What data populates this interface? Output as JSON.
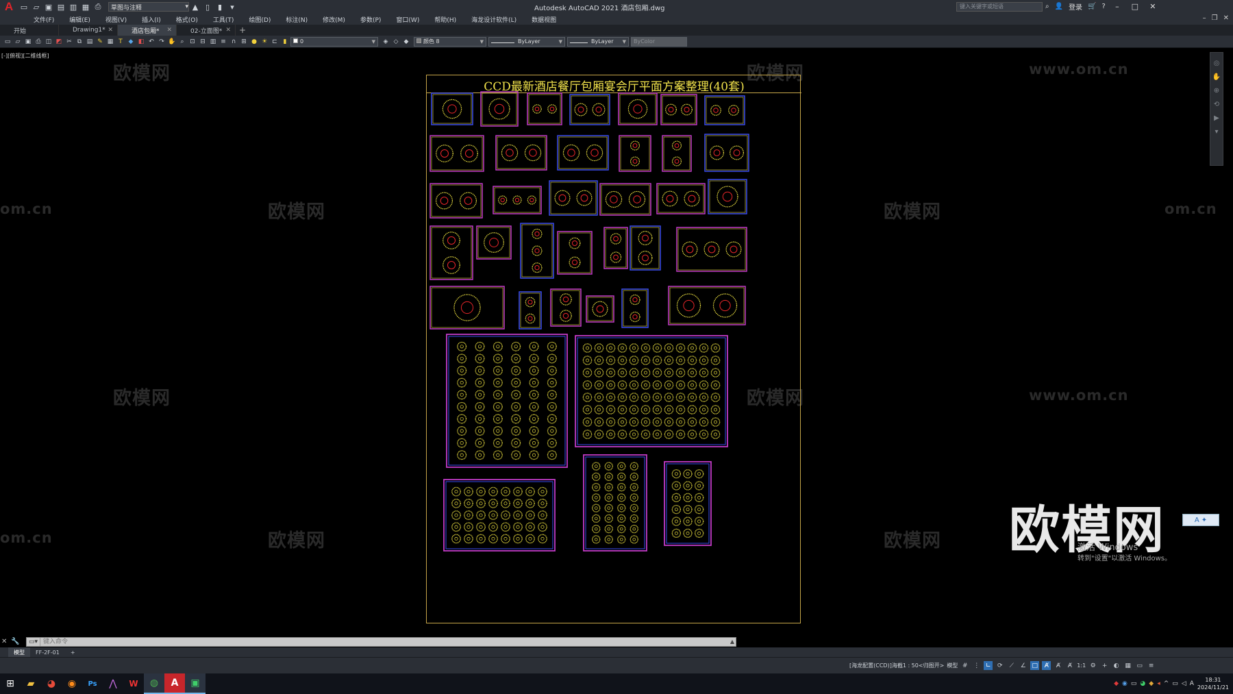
{
  "app": {
    "logo": "A",
    "title": "Autodesk AutoCAD 2021    酒店包厢.dwg",
    "workspace": "草图与注释",
    "search_placeholder": "键入关键字或短语",
    "sign_in": "登录"
  },
  "menu": [
    "文件(F)",
    "编辑(E)",
    "视图(V)",
    "插入(I)",
    "格式(O)",
    "工具(T)",
    "绘图(D)",
    "标注(N)",
    "修改(M)",
    "参数(P)",
    "窗口(W)",
    "帮助(H)",
    "海龙设计软件(L)",
    "数据视图"
  ],
  "tabs": [
    {
      "label": "开始",
      "closable": false,
      "active": false
    },
    {
      "label": "Drawing1*",
      "closable": true,
      "active": false
    },
    {
      "label": "酒店包厢*",
      "closable": true,
      "active": true
    },
    {
      "label": "02-立面图*",
      "closable": true,
      "active": false
    }
  ],
  "toolbar": {
    "layer_value": "0",
    "color_value": "颜色 8",
    "linetype_value": "ByLayer",
    "lineweight_value": "ByLayer",
    "plotstyle_value": "ByColor"
  },
  "viewport": {
    "label": "[-][俯视][二维线框]",
    "watermark_text": "欧模网",
    "watermark_url": "www.om.cn",
    "watermark_url_short": "om.cn",
    "big_watermark": "欧模网"
  },
  "sheet": {
    "title": "CCD最新酒店餐厅包厢宴会厅平面方案整理(40套)"
  },
  "activation": {
    "title": "激活 Windows",
    "subtitle": "转到\"设置\"以激活 Windows。"
  },
  "ime_badge": "A",
  "command": {
    "placeholder": "键入命令"
  },
  "layouts": [
    "模型",
    "FF-2F-01"
  ],
  "status": {
    "scale_label": "[海龙配置(CCD)]海截1 : 50<归图开>",
    "model": "模型",
    "annoscale": "1:1"
  },
  "clock": {
    "time": "18:31",
    "date": "2024/11/21"
  },
  "colors": {
    "accent": "#e0242a",
    "sheet_border": "#c9a84a",
    "title_yellow": "#f2e34b",
    "plan_yellow": "#f0e442",
    "plan_red": "#e8262a",
    "plan_blue": "#3a4cf0",
    "plan_magenta": "#c23bc7"
  }
}
